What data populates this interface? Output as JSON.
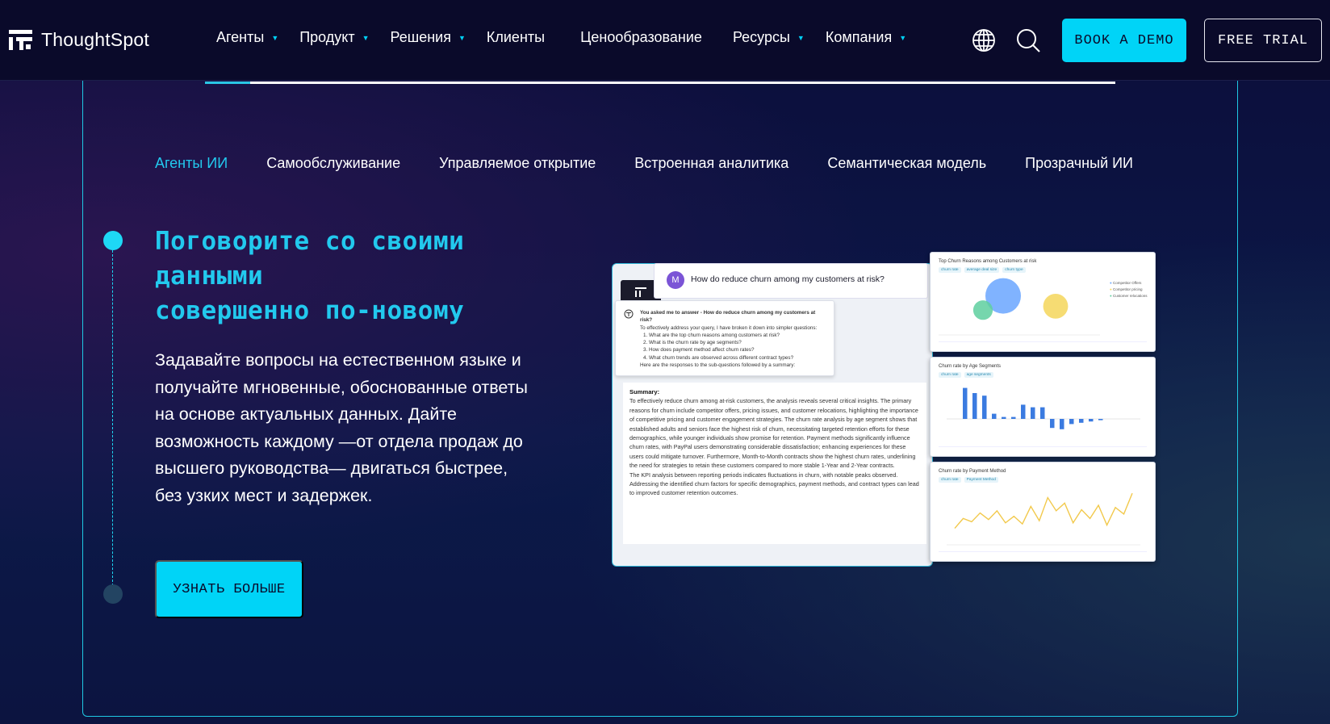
{
  "nav": {
    "logo_text": "ThoughtSpot",
    "menu": [
      {
        "label": "Агенты",
        "has_dropdown": true
      },
      {
        "label": "Продукт",
        "has_dropdown": true
      },
      {
        "label": "Решения",
        "has_dropdown": true
      },
      {
        "label": "Клиенты",
        "has_dropdown": false
      },
      {
        "label": "Ценообразование",
        "has_dropdown": false
      },
      {
        "label": "Ресурсы",
        "has_dropdown": true
      },
      {
        "label": "Компания",
        "has_dropdown": true
      }
    ],
    "icons": [
      "globe-icon",
      "search-icon"
    ],
    "book_demo": "BOOK A DEMO",
    "free_trial": "FREE TRIAL"
  },
  "carousel": {
    "progress": 0.05
  },
  "tabs": [
    {
      "label": "Агенты ИИ",
      "active": true
    },
    {
      "label": "Самообслуживание",
      "active": false
    },
    {
      "label": "Управляемое открытие",
      "active": false
    },
    {
      "label": "Встроенная аналитика",
      "active": false
    },
    {
      "label": "Семантическая модель",
      "active": false
    },
    {
      "label": "Прозрачный ИИ",
      "active": false
    }
  ],
  "hero": {
    "headline_line1": "Поговорите со своими",
    "headline_line2": "данными",
    "headline_line3": "совершенно по-новому",
    "body": "Задавайте вопросы на естественном языке и получайте мгновенные, обоснованные ответы на основе актуальных данных. Дайте возможность каждому —от отдела продаж до высшего руководства— двигаться быстрее, без узких мест и задержек.",
    "cta": "УЗНАТЬ БОЛЬШЕ"
  },
  "mockup": {
    "avatar_letter": "M",
    "question": "How do reduce churn among my customers at risk?",
    "ask_intro": "You asked me to answer - How do reduce churn among my customers at risk?",
    "ask_lines": [
      "To effectively address your query, I have broken it down into simpler questions:",
      "1. What are the top churn reasons among customers at risk?",
      "2. What is the churn rate by age segments?",
      "3. How does payment method affect churn rates?",
      "4. What churn trends are observed across different contract types?",
      "Here are the responses to the sub-questions followed by a summary:"
    ],
    "summary_title": "Summary:",
    "summary_text": "To effectively reduce churn among at-risk customers, the analysis reveals several critical insights. The primary reasons for churn include competitor offers, pricing issues, and customer relocations, highlighting the importance of competitive pricing and customer engagement strategies. The churn rate analysis by age segment shows that established adults and seniors face the highest risk of churn, necessitating targeted retention efforts for these demographics, while younger individuals show promise for retention. Payment methods significantly influence churn rates, with PayPal users demonstrating considerable dissatisfaction; enhancing experiences for these users could mitigate turnover. Furthermore, Month-to-Month contracts show the highest churn rates, underlining the need for strategies to retain these customers compared to more stable 1-Year and 2-Year contracts.",
    "summary_text2": "The KPI analysis between reporting periods indicates fluctuations in churn, with notable peaks observed. Addressing the identified churn factors for specific demographics, payment methods, and contract types can lead to improved customer retention outcomes.",
    "panel1_title": "Top Churn Reasons among Customers at risk",
    "panel1_chips": [
      "churn rate",
      "average deal size",
      "churn type"
    ],
    "panel1_legend": [
      "Competitor Offers",
      "Competitor pricing",
      "Customer relocations"
    ],
    "panel2_title": "Churn rate by Age Segments",
    "panel2_chips": [
      "churn rate",
      "age segments"
    ],
    "panel3_title": "Churn rate by Payment Method",
    "panel3_chips": [
      "churn rate",
      "Payment Method"
    ]
  },
  "chart_data": [
    {
      "type": "scatter",
      "title": "Top Churn Reasons among Customers at risk",
      "series": [
        {
          "name": "Competitor Offers",
          "color": "#6aa6ff",
          "x": [
            3.2
          ],
          "y": [
            3.4
          ],
          "size": [
            1.0
          ]
        },
        {
          "name": "Competitor pricing",
          "color": "#f5d65b",
          "x": [
            5.8
          ],
          "y": [
            2.6
          ],
          "size": [
            0.7
          ]
        },
        {
          "name": "Customer relocations",
          "color": "#5ecf9f",
          "x": [
            2.2
          ],
          "y": [
            2.3
          ],
          "size": [
            0.55
          ]
        }
      ]
    },
    {
      "type": "bar",
      "title": "Churn rate by Age Segments",
      "values": [
        48,
        40,
        36,
        8,
        3,
        3,
        22,
        18,
        18,
        -14,
        -16,
        -8,
        -6,
        -4,
        -2
      ],
      "color": "#3b7be0"
    },
    {
      "type": "line",
      "title": "Churn rate by Payment Method",
      "values": [
        30,
        48,
        42,
        58,
        46,
        62,
        40,
        52,
        38,
        70,
        44,
        86,
        62,
        76,
        40,
        64,
        48,
        72,
        36,
        68,
        56,
        94
      ],
      "color": "#f2c94c"
    }
  ]
}
